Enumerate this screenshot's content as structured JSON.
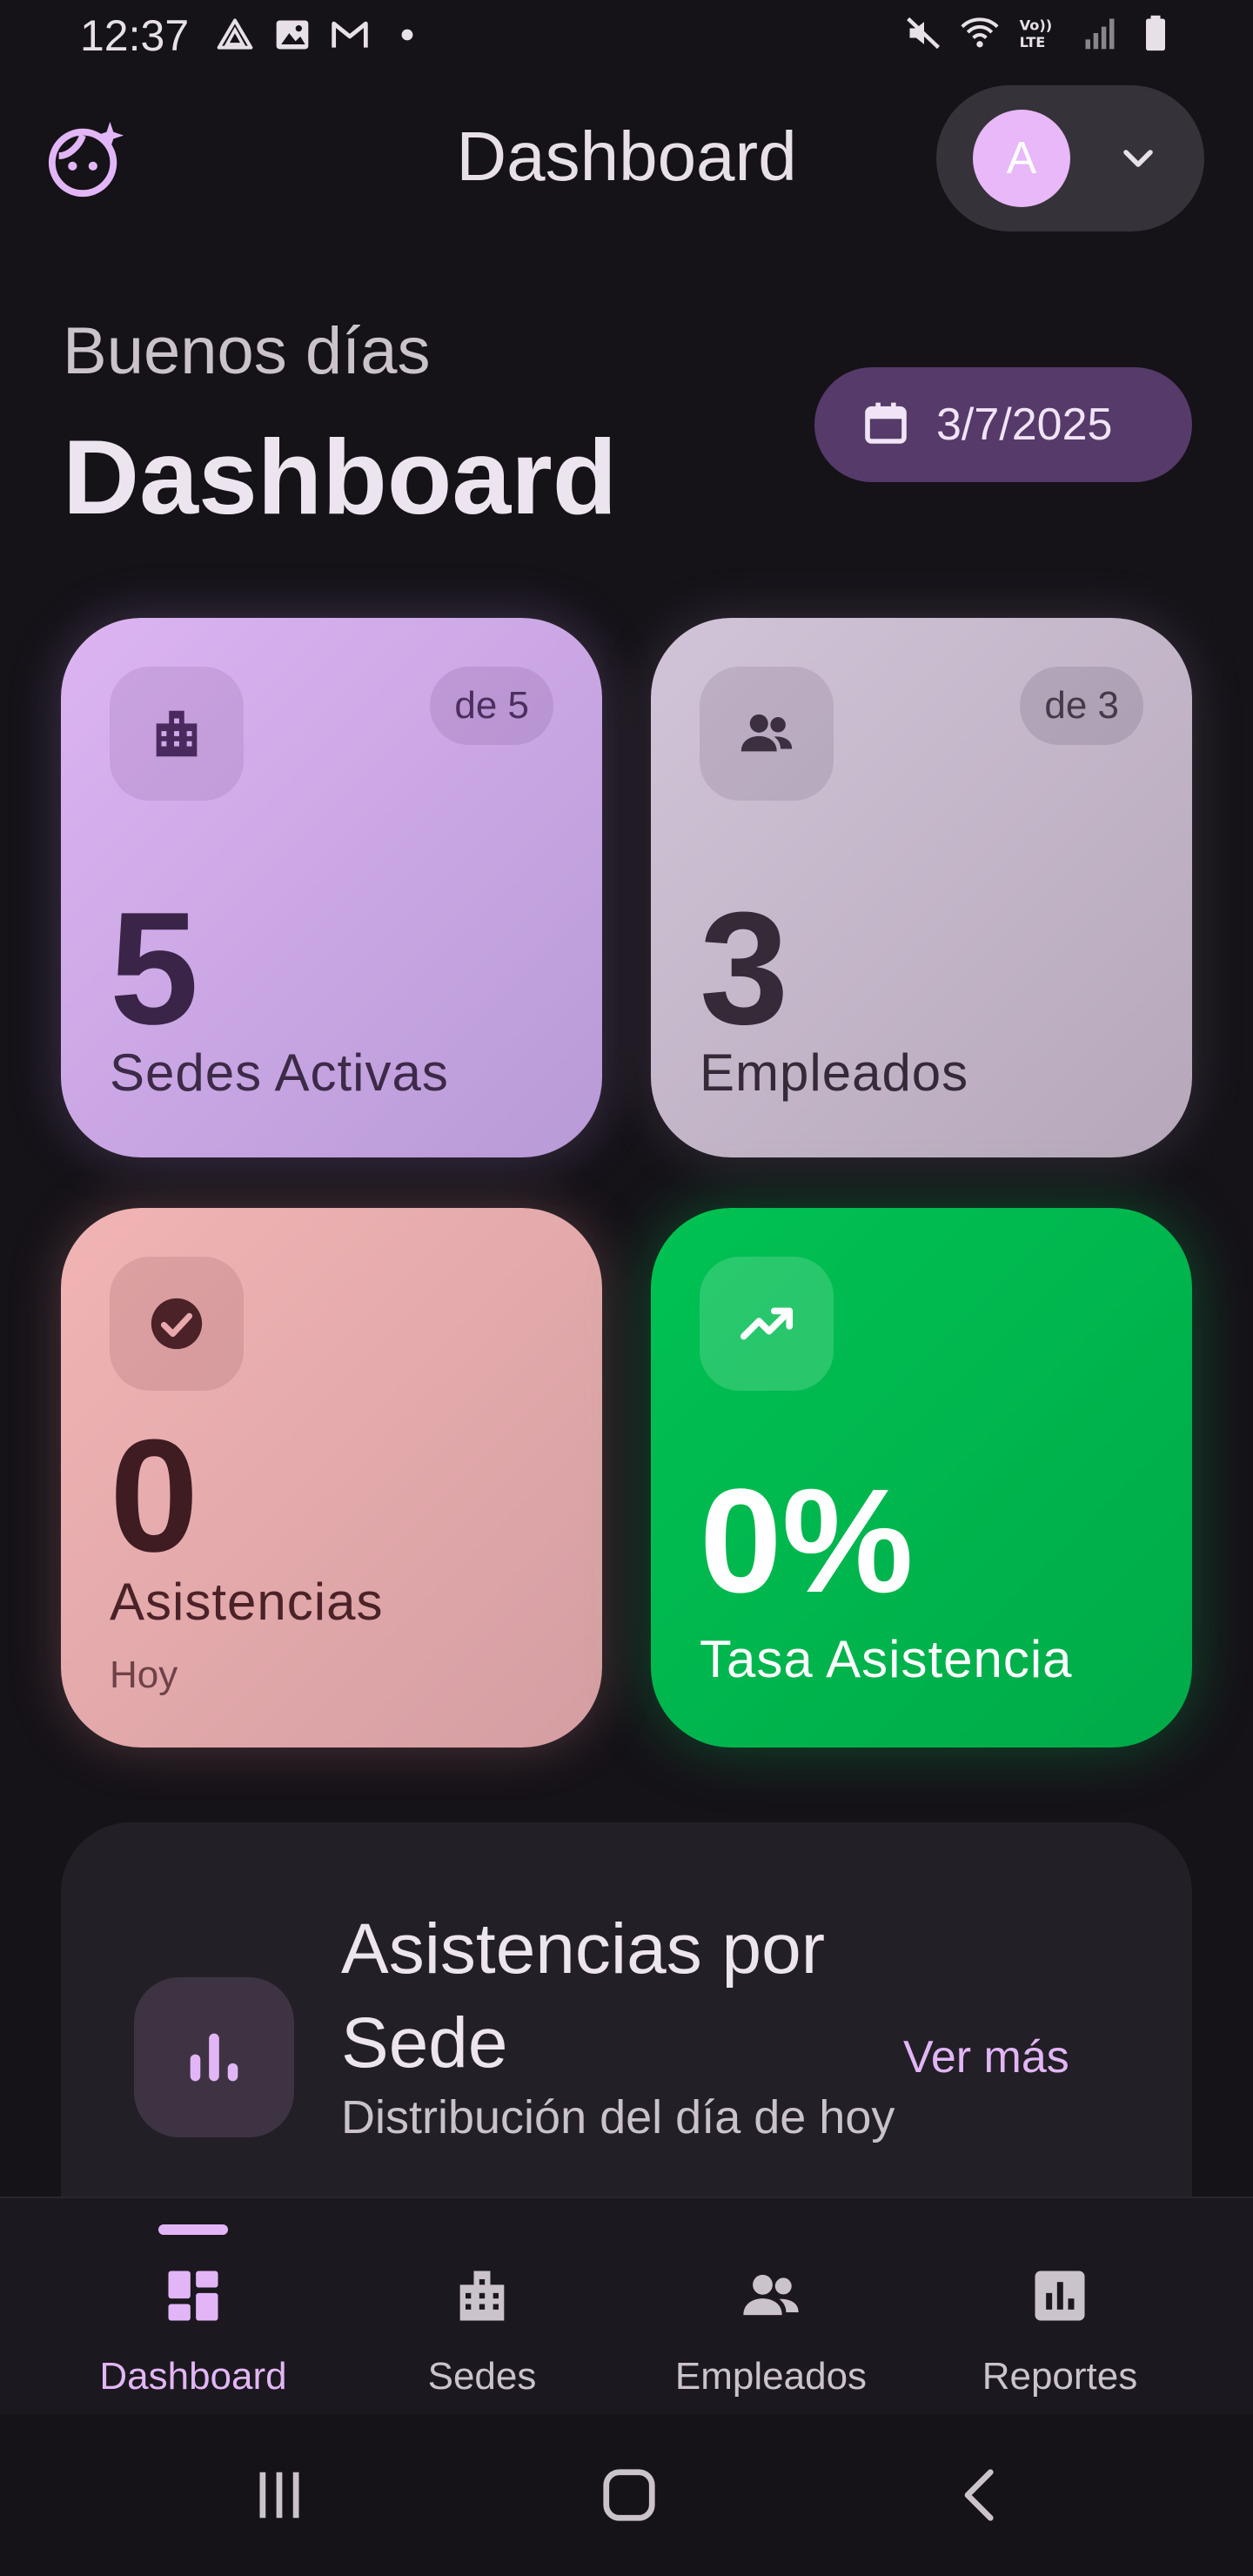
{
  "status_bar": {
    "time": "12:37",
    "left_icons": [
      "arrow-triangle-icon",
      "image-icon",
      "gmail-icon",
      "dot-icon"
    ],
    "right_icons": [
      "mute-icon",
      "wifi-icon",
      "volte-icon",
      "signal-icon",
      "battery-icon"
    ],
    "volte_label": "Vo)) LTE"
  },
  "app_bar": {
    "title": "Dashboard",
    "avatar_initial": "A"
  },
  "greeting": {
    "text": "Buenos días",
    "heading": "Dashboard",
    "date": "3/7/2025"
  },
  "stats": {
    "sedes": {
      "value": "5",
      "label": "Sedes Activas",
      "badge": "de 5",
      "icon": "building-icon"
    },
    "empleados": {
      "value": "3",
      "label": "Empleados",
      "badge": "de 3",
      "icon": "people-icon"
    },
    "asistencias": {
      "value": "0",
      "label": "Asistencias",
      "sublabel": "Hoy",
      "icon": "check-circle-icon"
    },
    "tasa": {
      "value": "0%",
      "label": "Tasa Asistencia",
      "icon": "trending-up-icon"
    }
  },
  "section": {
    "title": "Asistencias por Sede",
    "subtitle": "Distribución del día de hoy",
    "link": "Ver más",
    "icon": "bar-chart-icon"
  },
  "bottom_nav": {
    "items": [
      {
        "label": "Dashboard",
        "icon": "dashboard-icon",
        "active": true
      },
      {
        "label": "Sedes",
        "icon": "building-icon",
        "active": false
      },
      {
        "label": "Empleados",
        "icon": "people-icon",
        "active": false
      },
      {
        "label": "Reportes",
        "icon": "report-icon",
        "active": false
      }
    ]
  },
  "colors": {
    "background": "#151218",
    "accent": "#e2b6f6",
    "sedes_card": "#d6b0f0",
    "empleados_card": "#c9bcce",
    "asistencias_card": "#eaaeb0",
    "tasa_card": "#00bb4f"
  }
}
